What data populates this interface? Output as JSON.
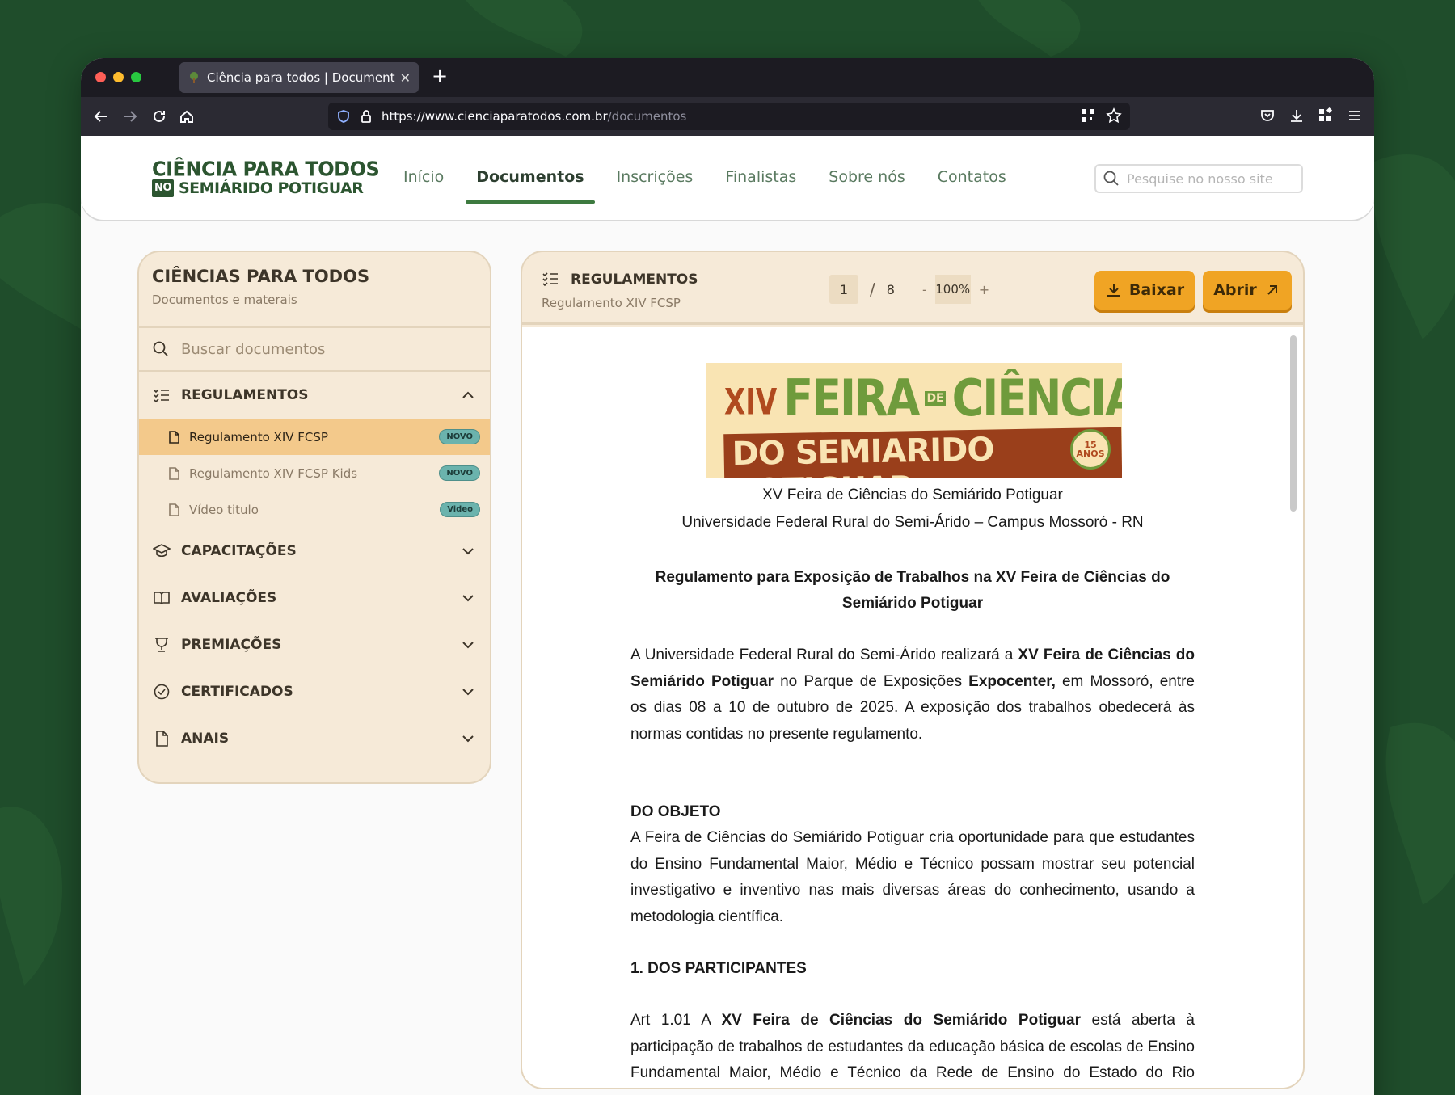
{
  "browser": {
    "tab_title": "Ciência para todos | Documentos",
    "url_host": "https://www.cienciaparatodos.com.br",
    "url_path": "/documentos"
  },
  "site": {
    "logo_line1": "CIÊNCIA PARA TODOS",
    "logo_box": "NO",
    "logo_line2": "SEMIÁRIDO POTIGUAR",
    "menu": [
      "Início",
      "Documentos",
      "Inscrições",
      "Finalistas",
      "Sobre nós",
      "Contatos"
    ],
    "active_menu": "Documentos",
    "search_placeholder": "Pesquise no nosso site"
  },
  "sidebar": {
    "title": "CIÊNCIAS PARA TODOS",
    "subtitle": "Documentos e materais",
    "search_placeholder": "Buscar documentos",
    "categories": [
      {
        "label": "REGULAMENTOS",
        "icon": "list-check-icon",
        "open": true
      },
      {
        "label": "CAPACITAÇÕES",
        "icon": "graduation-cap-icon"
      },
      {
        "label": "AVALIAÇÕES",
        "icon": "open-book-icon"
      },
      {
        "label": "PREMIAÇÕES",
        "icon": "trophy-icon"
      },
      {
        "label": "CERTIFICADOS",
        "icon": "badge-check-icon"
      },
      {
        "label": "ANAIS",
        "icon": "file-icon"
      }
    ],
    "documents": [
      {
        "label": "Regulamento XIV FCSP",
        "badge": "NOVO",
        "active": true
      },
      {
        "label": "Regulamento XIV FCSP Kids",
        "badge": "NOVO"
      },
      {
        "label": "Vídeo titulo",
        "badge": "Video"
      }
    ]
  },
  "viewer": {
    "title": "REGULAMENTOS",
    "subtitle": "Regulamento XIV FCSP",
    "page_current": "1",
    "page_sep": "/",
    "page_total": "8",
    "zoom_minus": "-",
    "zoom": "100%",
    "zoom_plus": "+",
    "download_label": "Baixar",
    "open_label": "Abrir",
    "colors": {
      "accent": "#f0a424",
      "panel": "#f6ead8",
      "brand_green": "#2c5530"
    }
  },
  "document": {
    "banner": {
      "xiv": "XIV",
      "feira": "FEIRA",
      "de": "DE",
      "ciencias": "CIÊNCIAS",
      "line2": "DO SEMIARIDO POTIGUAR",
      "seal": "15 ANOS"
    },
    "heading_line1": "XV Feira de Ciências do Semiárido Potiguar",
    "heading_line2": "Universidade Federal Rural do Semi-Árido – Campus Mossoró - RN",
    "reg_title_1": "Regulamento para Exposição de Trabalhos na XV Feira de Ciências do",
    "reg_title_2": "Semiárido Potiguar",
    "intro_a": "A Universidade Federal Rural do Semi-Árido realizará a ",
    "intro_b": "XV Feira de Ciências do Semiárido Potiguar",
    "intro_c": " no Parque de Exposições ",
    "intro_d": "Expocenter,",
    "intro_e": " em Mossoró, entre os dias 08 a 10 de outubro de 2025. A exposição dos trabalhos obedecerá às normas contidas no presente regulamento.",
    "objeto_title": "DO OBJETO",
    "objeto_text": "A Feira de Ciências do Semiárido Potiguar cria oportunidade para que estudantes do Ensino Fundamental Maior, Médio e Técnico possam mostrar seu potencial investigativo e inventivo nas mais diversas áreas do conhecimento, usando a metodologia científica.",
    "part_title": "1. DOS PARTICIPANTES",
    "art_a": "Art 1.01 A ",
    "art_b": "XV Feira de Ciências do Semiárido Potiguar",
    "art_c": " está aberta à participação de trabalhos de estudantes da educação básica de escolas de Ensino Fundamental Maior, Médio e Técnico da Rede de Ensino do Estado do Rio Grande do Norte e"
  }
}
